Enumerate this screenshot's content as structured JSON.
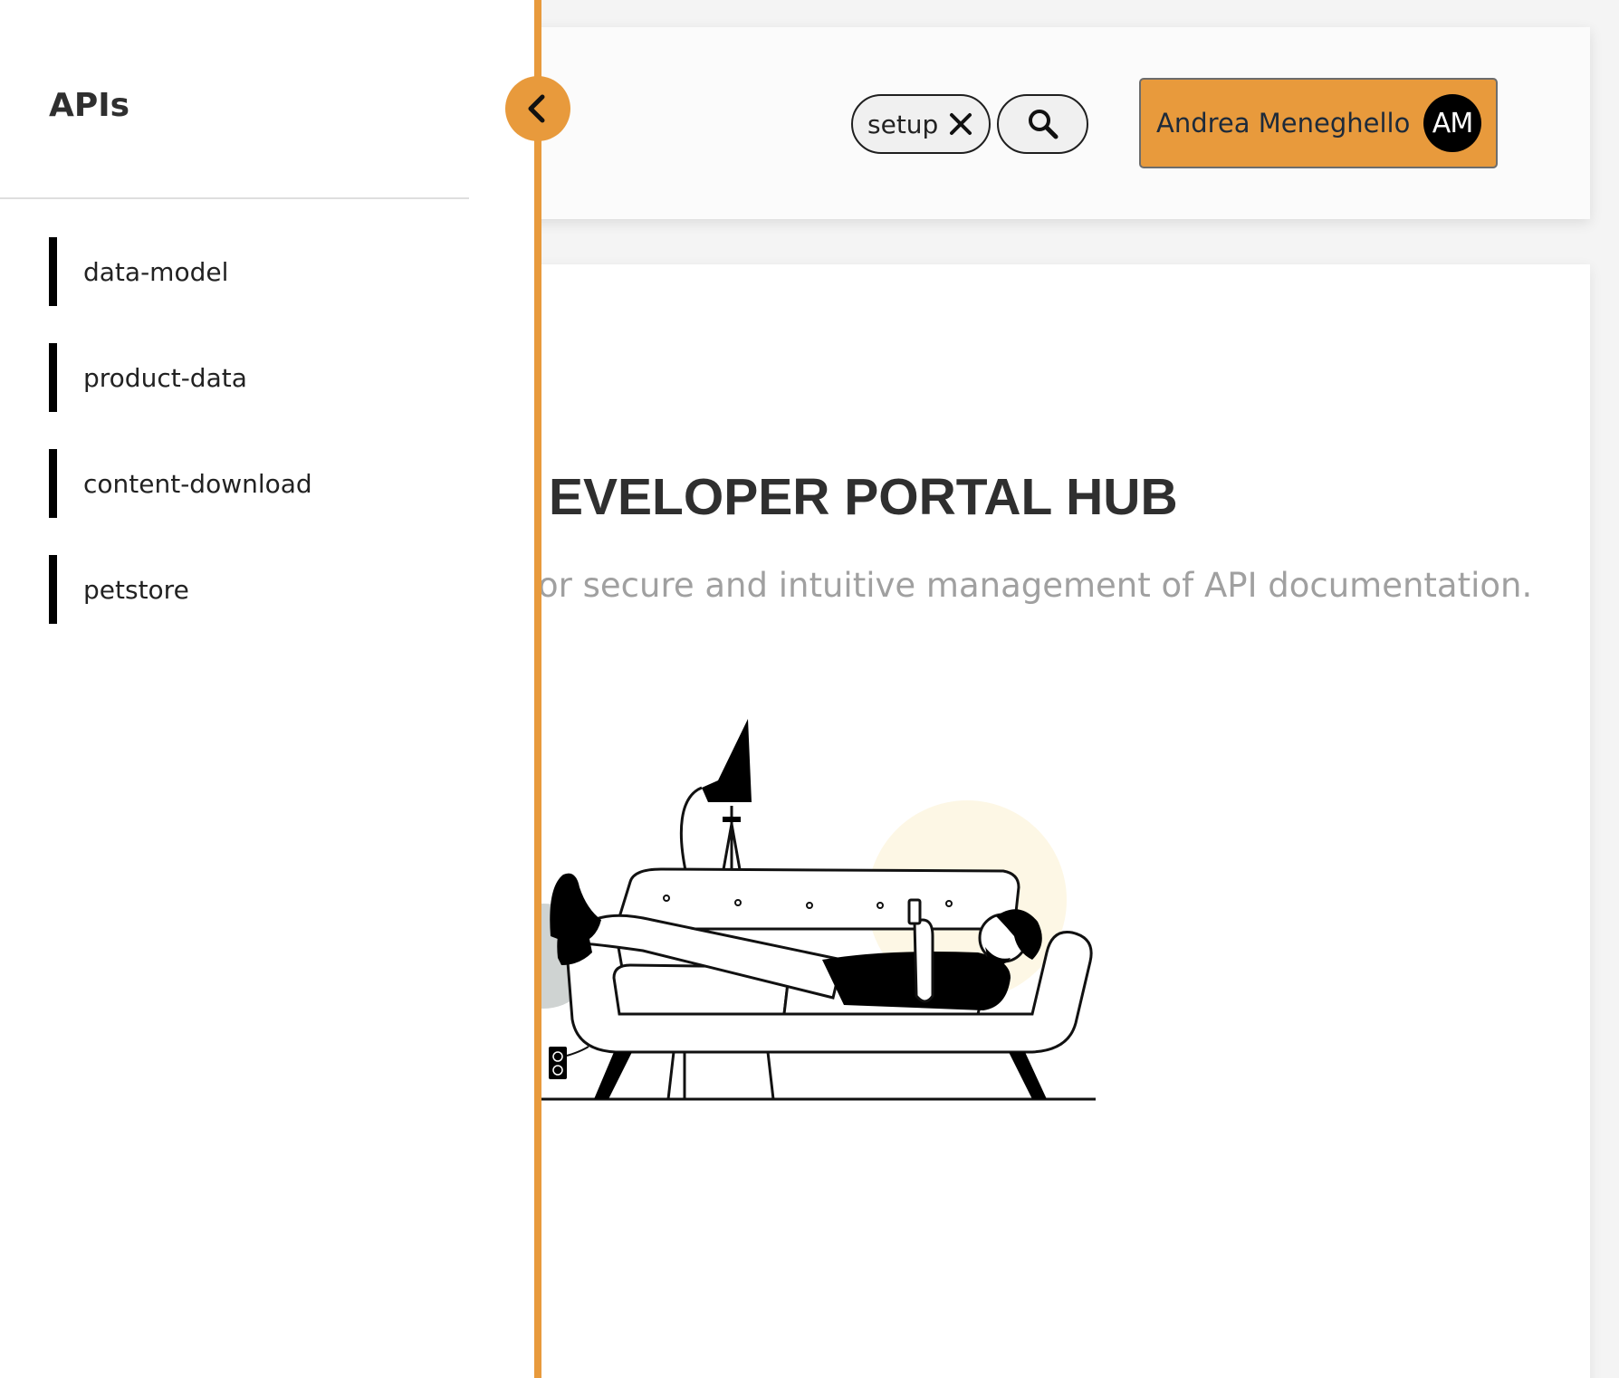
{
  "sidebar": {
    "title": "APIs",
    "items": [
      {
        "label": "data-model"
      },
      {
        "label": "product-data"
      },
      {
        "label": "content-download"
      },
      {
        "label": "petstore"
      }
    ],
    "collapse_icon": "chevron-left-icon"
  },
  "header": {
    "search_tag": "setup",
    "clear_icon": "close-icon",
    "search_icon": "search-icon",
    "user": {
      "name": "Andrea Meneghello",
      "initials": "AM"
    }
  },
  "main": {
    "title": "EVELOPER PORTAL HUB",
    "subtitle": "or secure and intuitive management of API documentation."
  },
  "colors": {
    "accent": "#e89a3c",
    "nav_indicator": "#000000",
    "subtitle": "#a0a0a0"
  }
}
